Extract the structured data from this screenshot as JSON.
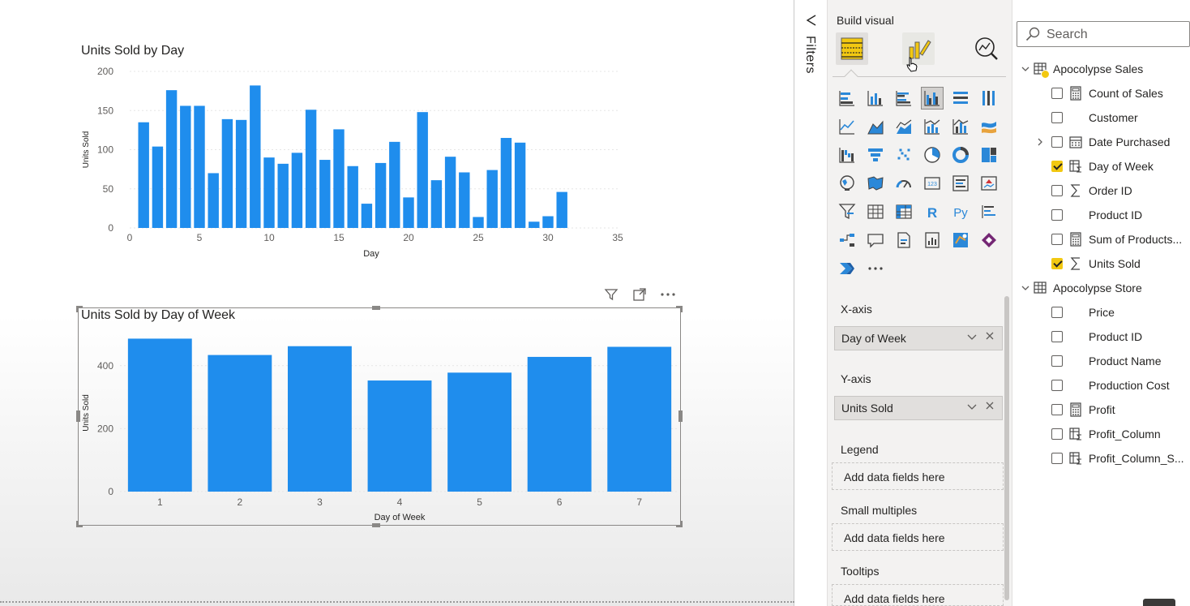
{
  "canvas": {
    "chart1_title": "Units Sold by Day",
    "chart2_title": "Units Sold by Day of Week"
  },
  "chart_data": [
    {
      "type": "bar",
      "title": "Units Sold by Day",
      "xlabel": "Day",
      "ylabel": "Units Sold",
      "x": [
        1,
        2,
        3,
        4,
        5,
        6,
        7,
        8,
        9,
        10,
        11,
        12,
        13,
        14,
        15,
        16,
        17,
        18,
        19,
        20,
        21,
        22,
        23,
        24,
        25,
        26,
        27,
        28,
        29,
        30,
        31
      ],
      "values": [
        135,
        104,
        176,
        156,
        156,
        70,
        139,
        138,
        182,
        90,
        82,
        96,
        151,
        87,
        126,
        79,
        31,
        83,
        110,
        39,
        148,
        61,
        91,
        71,
        14,
        74,
        115,
        109,
        8,
        15,
        46
      ],
      "xlim": [
        0,
        35
      ],
      "ylim": [
        0,
        200
      ],
      "xticks": [
        0,
        5,
        10,
        15,
        20,
        25,
        30,
        35
      ],
      "yticks": [
        0,
        50,
        100,
        150,
        200
      ],
      "color": "#1f8ded",
      "grid": true
    },
    {
      "type": "bar",
      "title": "Units Sold by Day of Week",
      "xlabel": "Day of Week",
      "ylabel": "Units Sold",
      "categories": [
        "1",
        "2",
        "3",
        "4",
        "5",
        "6",
        "7"
      ],
      "values": [
        486,
        434,
        462,
        353,
        378,
        428,
        460
      ],
      "ylim": [
        0,
        500
      ],
      "yticks": [
        0,
        200,
        400
      ],
      "color": "#1f8ded",
      "grid": true
    }
  ],
  "filters": {
    "label": "Filters"
  },
  "viz_pane": {
    "build_visual_label": "Build visual",
    "more_visuals": "···",
    "wells": [
      {
        "label": "X-axis",
        "field": "Day of Week"
      },
      {
        "label": "Y-axis",
        "field": "Units Sold"
      },
      {
        "label": "Legend",
        "placeholder": "Add data fields here"
      },
      {
        "label": "Small multiples",
        "placeholder": "Add data fields here"
      },
      {
        "label": "Tooltips",
        "placeholder": "Add data fields here"
      }
    ]
  },
  "data_pane": {
    "search_placeholder": "Search",
    "tables": [
      {
        "name": "Apocolypse Sales",
        "fields": [
          {
            "name": "Count of Sales",
            "icon": "calculator-icon",
            "checked": false
          },
          {
            "name": "Customer",
            "icon": "",
            "checked": false
          },
          {
            "name": "Date Purchased",
            "icon": "calendar-icon",
            "checked": false,
            "expandable": true
          },
          {
            "name": "Day of Week",
            "icon": "calc-column-icon",
            "checked": true
          },
          {
            "name": "Order ID",
            "icon": "sigma-icon",
            "checked": false
          },
          {
            "name": "Product ID",
            "icon": "",
            "checked": false
          },
          {
            "name": "Sum of Products...",
            "icon": "calculator-icon",
            "checked": false
          },
          {
            "name": "Units Sold",
            "icon": "sigma-icon",
            "checked": true
          }
        ]
      },
      {
        "name": "Apocolypse Store",
        "fields": [
          {
            "name": "Price",
            "icon": "",
            "checked": false
          },
          {
            "name": "Product ID",
            "icon": "",
            "checked": false
          },
          {
            "name": "Product Name",
            "icon": "",
            "checked": false
          },
          {
            "name": "Production Cost",
            "icon": "",
            "checked": false
          },
          {
            "name": "Profit",
            "icon": "calculator-icon",
            "checked": false
          },
          {
            "name": "Profit_Column",
            "icon": "calc-column-icon",
            "checked": false
          },
          {
            "name": "Profit_Column_S...",
            "icon": "calc-column-icon",
            "checked": false
          }
        ]
      }
    ]
  }
}
